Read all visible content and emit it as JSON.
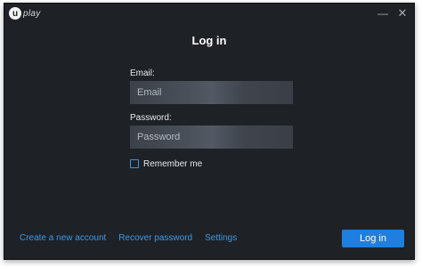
{
  "app": {
    "logo_text": "play",
    "logo_glyph": "u"
  },
  "titlebar": {
    "minimize_icon": "minimize-icon",
    "close_icon": "close-icon"
  },
  "login": {
    "heading": "Log in",
    "email_label": "Email:",
    "email_placeholder": "Email",
    "password_label": "Password:",
    "password_placeholder": "Password",
    "remember_label": "Remember me",
    "submit_label": "Log in"
  },
  "footer": {
    "create_account": "Create a new account",
    "recover_password": "Recover password",
    "settings": "Settings"
  },
  "colors": {
    "background": "#1e2126",
    "accent": "#1f7fe0",
    "link": "#3c9ae8"
  }
}
